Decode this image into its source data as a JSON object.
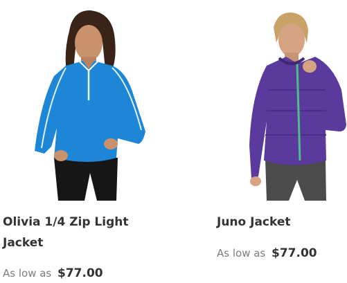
{
  "products": [
    {
      "name": "Olivia 1/4 Zip Light Jacket",
      "price_label": "As low as",
      "price": "$77.00",
      "color": "#1e86d6"
    },
    {
      "name": "Juno Jacket",
      "price_label": "As low as",
      "price": "$77.00",
      "color": "#5b3a9e"
    }
  ]
}
